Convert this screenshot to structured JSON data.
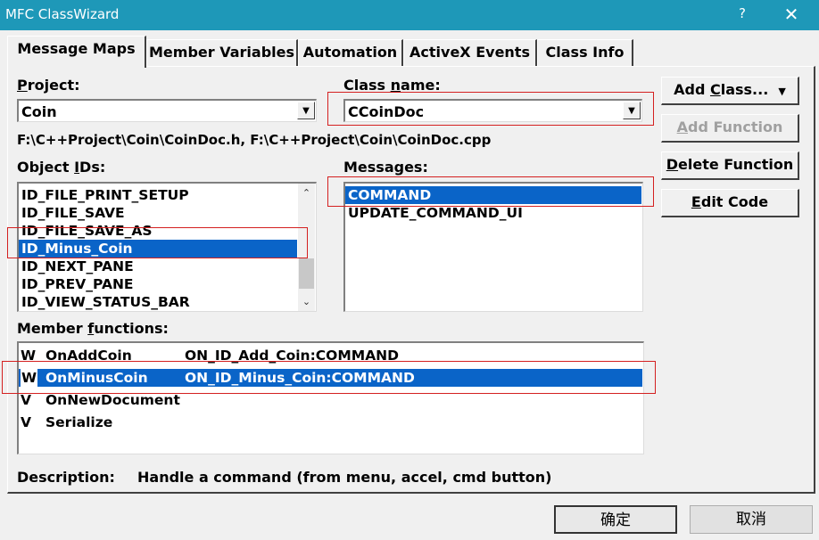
{
  "window": {
    "title": "MFC ClassWizard",
    "help": "?",
    "close": "✕"
  },
  "tabs": [
    {
      "label": "Message Maps"
    },
    {
      "label": "Member Variables"
    },
    {
      "label": "Automation"
    },
    {
      "label": "ActiveX Events"
    },
    {
      "label": "Class Info"
    }
  ],
  "project": {
    "label_pre": "",
    "label_u": "P",
    "label_post": "roject:",
    "value": "Coin"
  },
  "class_name": {
    "label_pre": "Class ",
    "label_u": "n",
    "label_post": "ame:",
    "value": "CCoinDoc"
  },
  "file_path": "F:\\C++Project\\Coin\\CoinDoc.h, F:\\C++Project\\Coin\\CoinDoc.cpp",
  "object_ids": {
    "label_pre": "Object ",
    "label_u": "I",
    "label_post": "Ds:",
    "items": [
      "ID_FILE_PRINT_SETUP",
      "ID_FILE_SAVE",
      "ID_FILE_SAVE_AS",
      "ID_Minus_Coin",
      "ID_NEXT_PANE",
      "ID_PREV_PANE",
      "ID_VIEW_STATUS_BAR"
    ],
    "selected": 3
  },
  "messages": {
    "label": "Messages:",
    "items": [
      "COMMAND",
      "UPDATE_COMMAND_UI"
    ],
    "selected": 0
  },
  "member_functions": {
    "label_pre": "Member ",
    "label_u": "f",
    "label_post": "unctions:",
    "rows": [
      {
        "badge": "W",
        "name": "OnAddCoin",
        "map": "ON_ID_Add_Coin:COMMAND"
      },
      {
        "badge": "W",
        "name": "OnMinusCoin",
        "map": "ON_ID_Minus_Coin:COMMAND"
      },
      {
        "badge": "V",
        "name": "OnNewDocument",
        "map": ""
      },
      {
        "badge": "V",
        "name": "Serialize",
        "map": ""
      }
    ],
    "selected": 1
  },
  "description": {
    "label": "Description:",
    "text": "Handle a command (from menu, accel, cmd button)"
  },
  "buttons": {
    "add_class_pre": "Add ",
    "add_class_u": "C",
    "add_class_post": "lass...",
    "add_class_arrow": "▼",
    "add_function_pre": "",
    "add_function_u": "A",
    "add_function_post": "dd Function",
    "delete_function_pre": "",
    "delete_function_u": "D",
    "delete_function_post": "elete Function",
    "edit_code_pre": "",
    "edit_code_u": "E",
    "edit_code_post": "dit Code",
    "ok": "确定",
    "cancel": "取消"
  },
  "colors": {
    "titlebar": "#1e98b8",
    "selection": "#0a64c8",
    "highlight_box": "#d42020"
  }
}
